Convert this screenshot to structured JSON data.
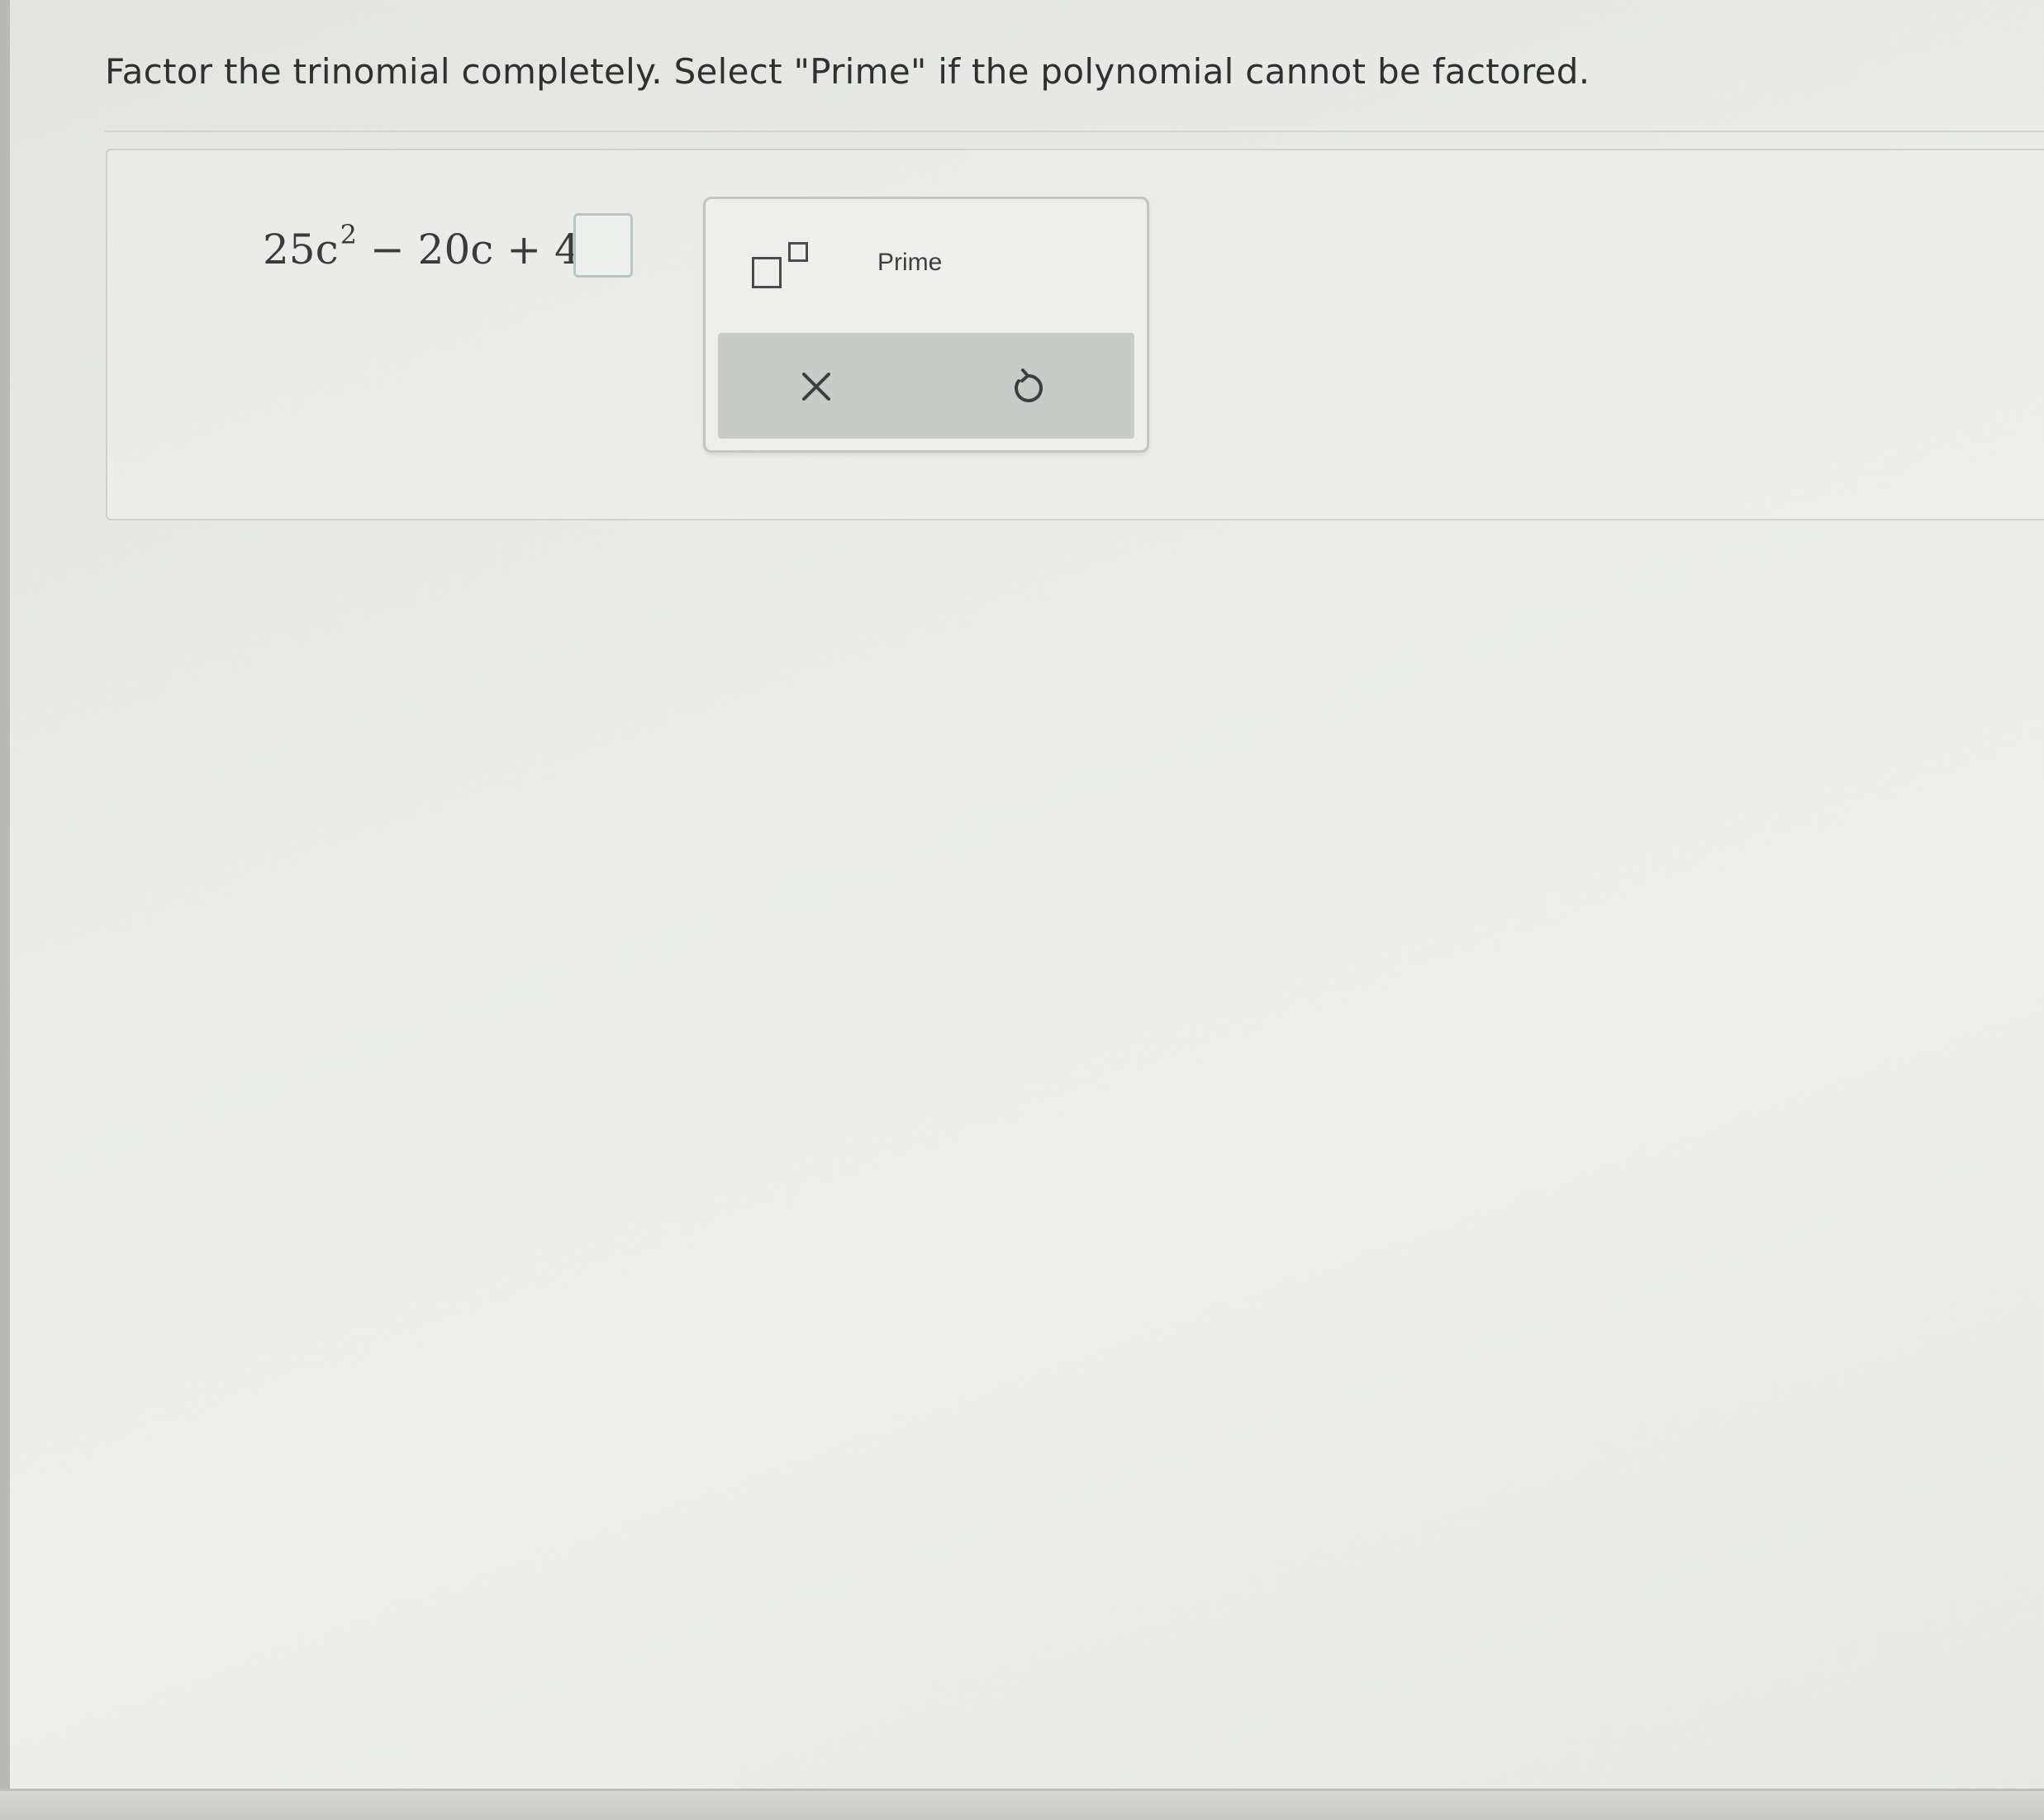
{
  "question": {
    "instructions": "Factor the trinomial completely. Select \"Prime\" if the polynomial cannot be factored.",
    "equation": {
      "lhs_start": "25c",
      "lhs_exponent": "2",
      "lhs_rest": " − 20c + 4 ="
    },
    "answer_value": ""
  },
  "palette": {
    "exponent_icon": "exponent-template-icon",
    "prime_label": "Prime",
    "clear_icon": "close-x-icon",
    "reset_icon": "undo-arrow-icon"
  },
  "colors": {
    "answer_box_border": "#b7c7c3",
    "action_bar": "#c8ccc9",
    "text": "#2f3030"
  }
}
